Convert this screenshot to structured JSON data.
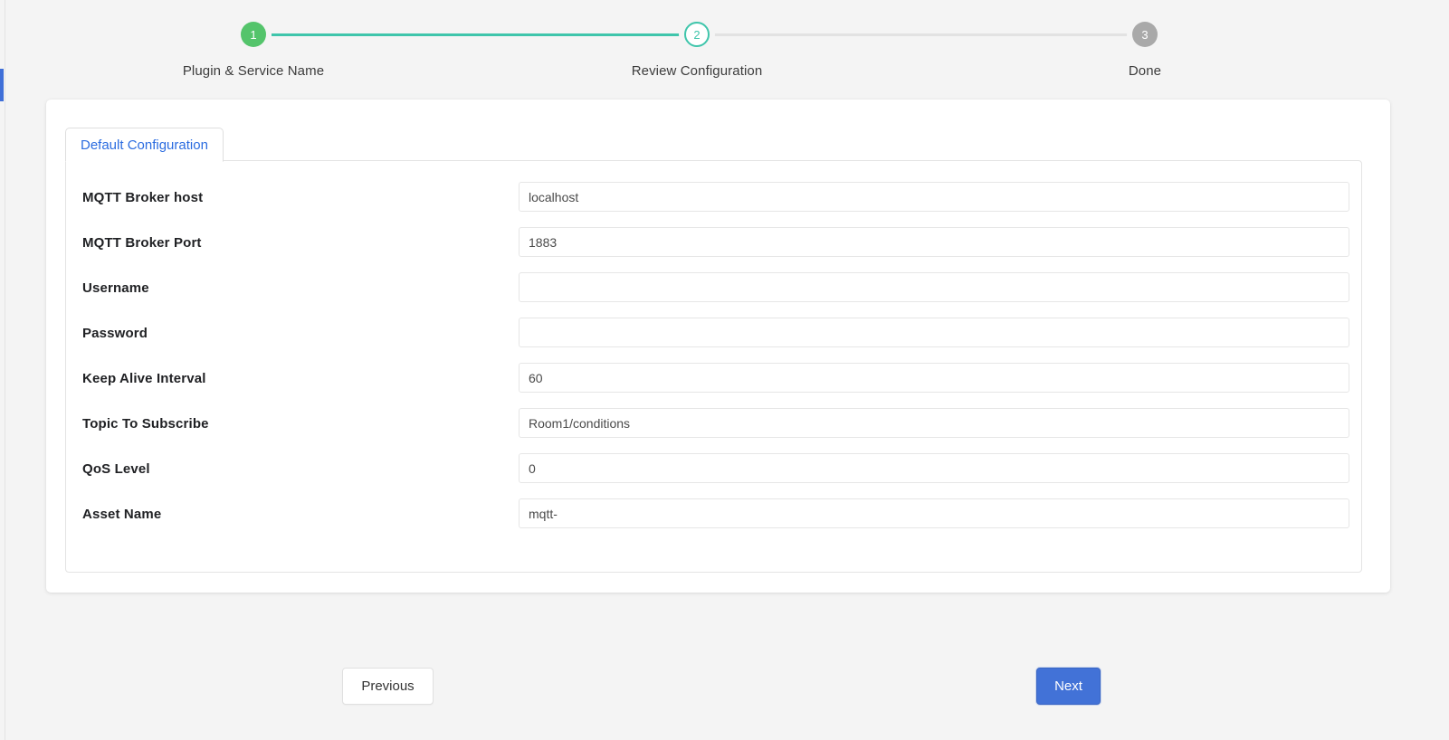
{
  "stepper": {
    "steps": [
      {
        "number": "1",
        "label": "Plugin & Service Name",
        "state": "done"
      },
      {
        "number": "2",
        "label": "Review Configuration",
        "state": "current"
      },
      {
        "number": "3",
        "label": "Done",
        "state": "pending"
      }
    ],
    "colors": {
      "done": "#54c46b",
      "current": "#3fc5ab",
      "pending": "#a9a9a9",
      "connector_active": "#3fc5ab",
      "connector_inactive": "#e2e2e2"
    }
  },
  "tabs": [
    {
      "label": "Default Configuration",
      "active": true
    }
  ],
  "form": {
    "fields": [
      {
        "label": "MQTT Broker host",
        "value": "localhost",
        "placeholder": ""
      },
      {
        "label": "MQTT Broker Port",
        "value": "1883",
        "placeholder": ""
      },
      {
        "label": "Username",
        "value": "",
        "placeholder": ""
      },
      {
        "label": "Password",
        "value": "",
        "placeholder": ""
      },
      {
        "label": "Keep Alive Interval",
        "value": "60",
        "placeholder": ""
      },
      {
        "label": "Topic To Subscribe",
        "value": "Room1/conditions",
        "placeholder": ""
      },
      {
        "label": "QoS Level",
        "value": "0",
        "placeholder": ""
      },
      {
        "label": "Asset Name",
        "value": "mqtt-",
        "placeholder": ""
      }
    ]
  },
  "footer": {
    "previous_label": "Previous",
    "next_label": "Next",
    "next_color": "#4272d7"
  }
}
